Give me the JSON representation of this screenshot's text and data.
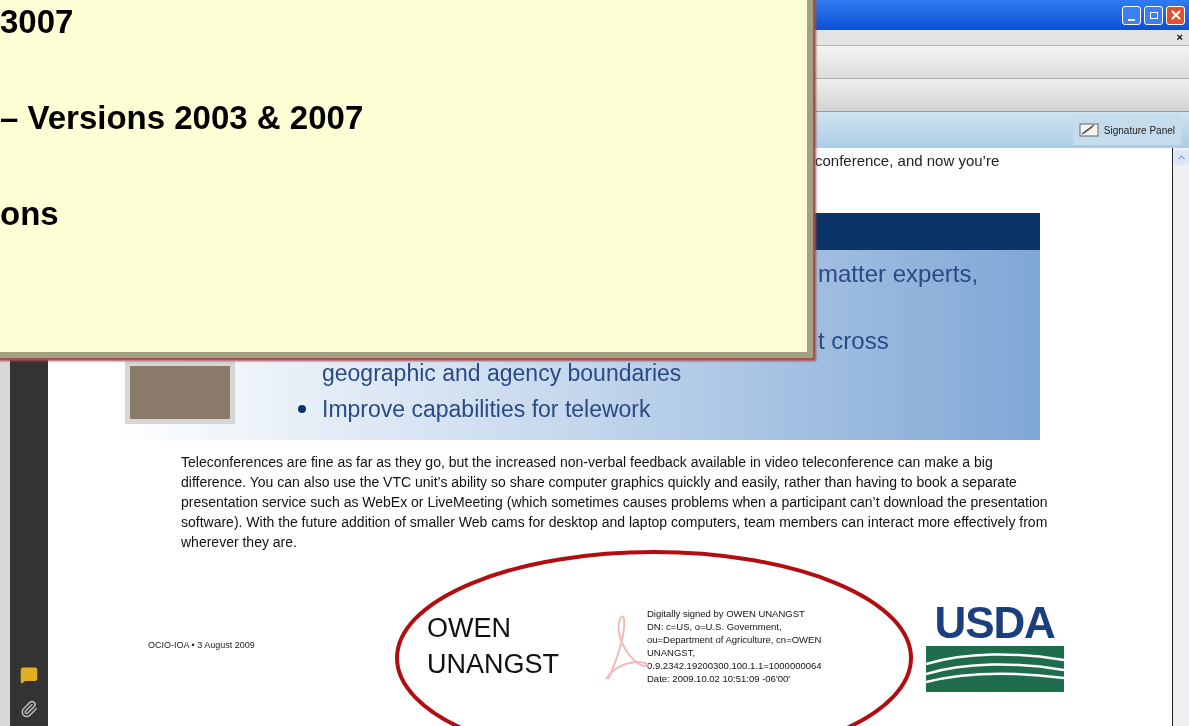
{
  "callout": {
    "lines": [
      "3007",
      "– Versions 2003 & 2007",
      "ons"
    ]
  },
  "window": {
    "close_document": "×"
  },
  "signature_bar": {
    "button": "Signature Panel"
  },
  "document": {
    "intro_fragment": "conference, and now you’re",
    "slide": {
      "fragments": [
        "matter experts,",
        "t cross"
      ],
      "bullet_continuation": "geographic and agency boundaries",
      "bullets": [
        "Improve capabilities for telework"
      ]
    },
    "paragraph": "Teleconferences are fine as far as they go, but the increased non-verbal feedback available in video teleconference can make a big difference. You can also use the VTC unit’s ability so share computer graphics quickly and easily, rather than having to book a separate presentation service such as WebEx or LiveMeeting (which sometimes causes problems when a participant can’t download the presentation software). With the future addition of smaller Web cams for desktop and laptop computers, team members can interact more effectively from wherever they are.",
    "footer": {
      "date": "OCIO-IOA • 3 August 2009",
      "signer_name": [
        "OWEN",
        "UNANGST"
      ],
      "signature_details": [
        "Digitally signed by OWEN UNANGST",
        "DN: c=US, o=U.S. Government,",
        "ou=Department of Agriculture, cn=OWEN",
        "UNANGST,",
        "0.9.2342.19200300.100.1.1=1000000064",
        "Date: 2009.10.02 10:51:09 -06'00'"
      ],
      "logo_text": "USDA"
    }
  }
}
